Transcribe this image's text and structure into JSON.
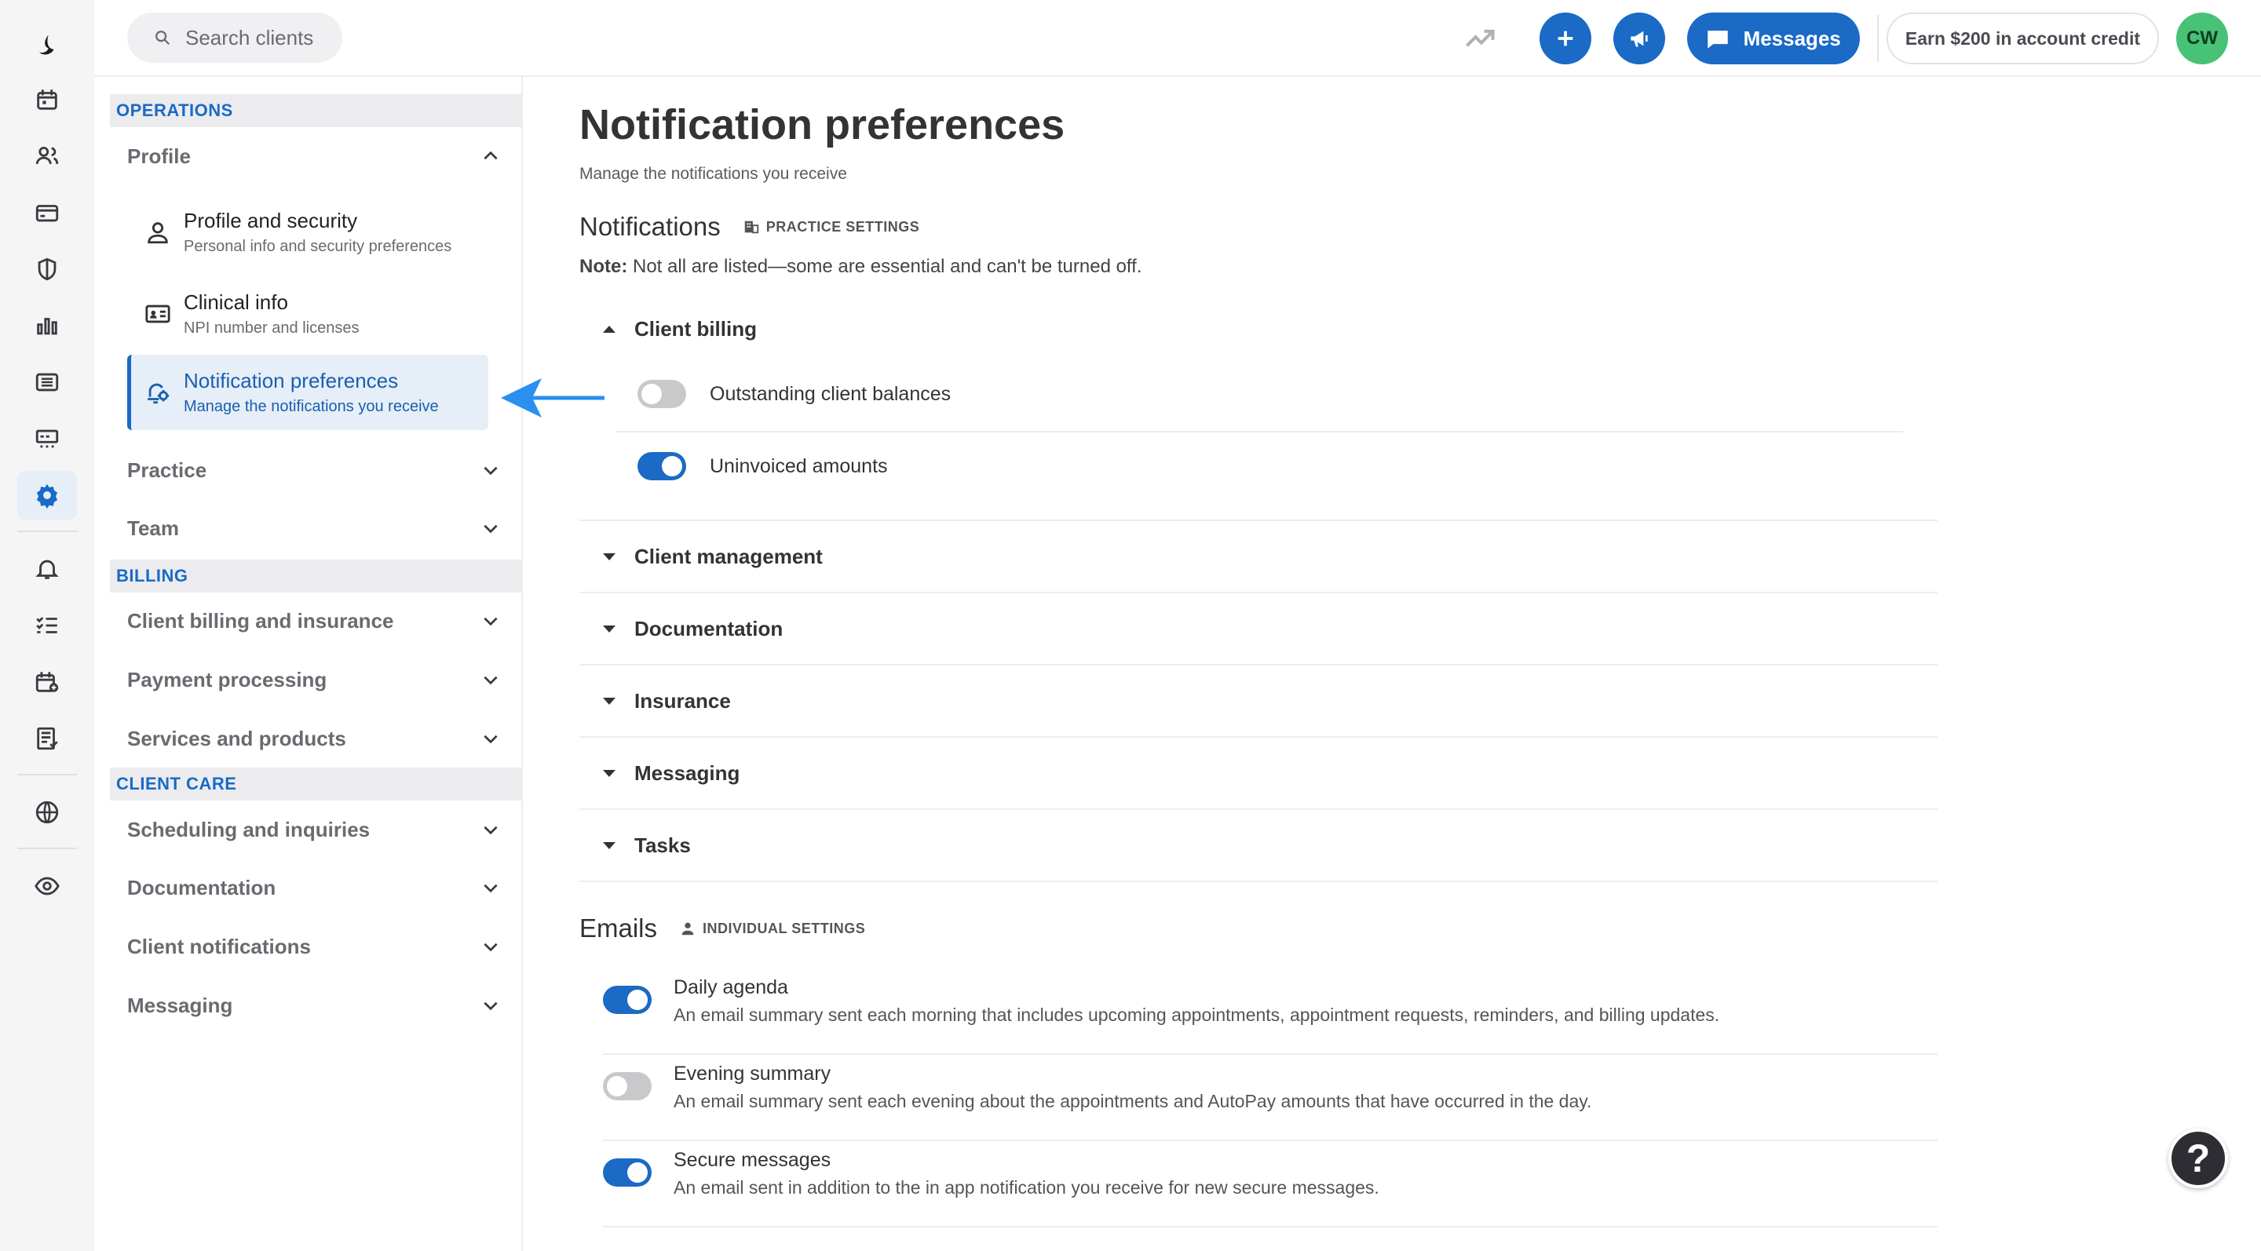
{
  "topbar": {
    "search_placeholder": "Search clients",
    "messages_label": "Messages",
    "earn_label": "Earn $200 in account credit",
    "avatar_initials": "CW"
  },
  "rail": {
    "icons": [
      "calendar-icon",
      "clients-icon",
      "billing-icon",
      "insurance-shield-icon",
      "analytics-icon",
      "records-icon",
      "marketplace-icon",
      "settings-gear-icon",
      "bell-icon",
      "tasks-icon",
      "calendar-add-icon",
      "notes-icon",
      "globe-icon",
      "eye-icon"
    ],
    "active": "settings-gear-icon"
  },
  "nav": {
    "operations_header": "OPERATIONS",
    "profile_group": "Profile",
    "profile_items": [
      {
        "title": "Profile and security",
        "desc": "Personal info and security preferences",
        "icon": "person-icon"
      },
      {
        "title": "Clinical info",
        "desc": "NPI number and licenses",
        "icon": "id-card-icon"
      },
      {
        "title": "Notification preferences",
        "desc": "Manage the notifications you receive",
        "icon": "bell-settings-icon"
      }
    ],
    "practice_group": "Practice",
    "team_group": "Team",
    "billing_header": "BILLING",
    "billing_groups": [
      "Client billing and insurance",
      "Payment processing",
      "Services and products"
    ],
    "client_care_header": "CLIENT CARE",
    "client_care_groups": [
      "Scheduling and inquiries",
      "Documentation",
      "Client notifications",
      "Messaging"
    ]
  },
  "main": {
    "title": "Notification preferences",
    "subtitle": "Manage the notifications you receive",
    "notifications_heading": "Notifications",
    "notifications_tag": "PRACTICE SETTINGS",
    "note_label": "Note:",
    "note_text": "Not all are listed—some are essential and can't be turned off.",
    "client_billing": {
      "label": "Client billing",
      "items": [
        {
          "label": "Outstanding client balances",
          "enabled": false
        },
        {
          "label": "Uninvoiced amounts",
          "enabled": true
        }
      ]
    },
    "categories": [
      "Client management",
      "Documentation",
      "Insurance",
      "Messaging",
      "Tasks"
    ],
    "emails_heading": "Emails",
    "emails_tag": "INDIVIDUAL SETTINGS",
    "emails": [
      {
        "title": "Daily agenda",
        "desc": "An email summary sent each morning that includes upcoming appointments, appointment requests, reminders, and billing updates.",
        "enabled": true
      },
      {
        "title": "Evening summary",
        "desc": "An email summary sent each evening about the appointments and AutoPay amounts that have occurred in the day.",
        "enabled": false
      },
      {
        "title": "Secure messages",
        "desc": "An email sent in addition to the in app notification you receive for new secure messages.",
        "enabled": true
      }
    ]
  },
  "help_label": "?",
  "colors": {
    "accent": "#1a6ac6",
    "avatar": "#47c276",
    "toggle_off": "#c9c9cc"
  }
}
